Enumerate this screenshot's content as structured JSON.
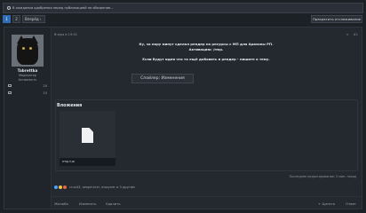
{
  "notice": "В ожидании одобрения перед публикацией на обозрение...",
  "pagination": {
    "current": "1",
    "next": "2",
    "next_label": "Вперёд ›"
  },
  "watch_button": "Прекратить отслеживание",
  "post": {
    "date": "Вчера в 19:01",
    "tools": [
      "<",
      "#1"
    ],
    "author": {
      "name": "Tabrettka",
      "title": "Модератор",
      "status": "Активность",
      "stats": [
        {
          "icon": "message-icon",
          "value": "20"
        },
        {
          "icon": "thumb-icon",
          "value": "15"
        }
      ]
    },
    "lines": [
      "Ку, за пару минут сделал рендер на ресурсы с МП для Аризоны РП.",
      "Активацию: /rmp.",
      "",
      "Если будут идеи что то ещё добавить в рендер - пишите о тему."
    ],
    "spoiler_button": "Спойлер: Изменения",
    "attachments_title": "Вложения",
    "attachment_file": "rmp.lua",
    "edited_note": "Последнее редактирование: 2 мин. назад",
    "reactions_text": "crux43, sergei-krei, maxyner и 3 другим",
    "actions_left": [
      "Жалоба",
      "Изменить",
      "Удалить"
    ],
    "actions_right": [
      "+ Цитата",
      "Ответ"
    ]
  }
}
